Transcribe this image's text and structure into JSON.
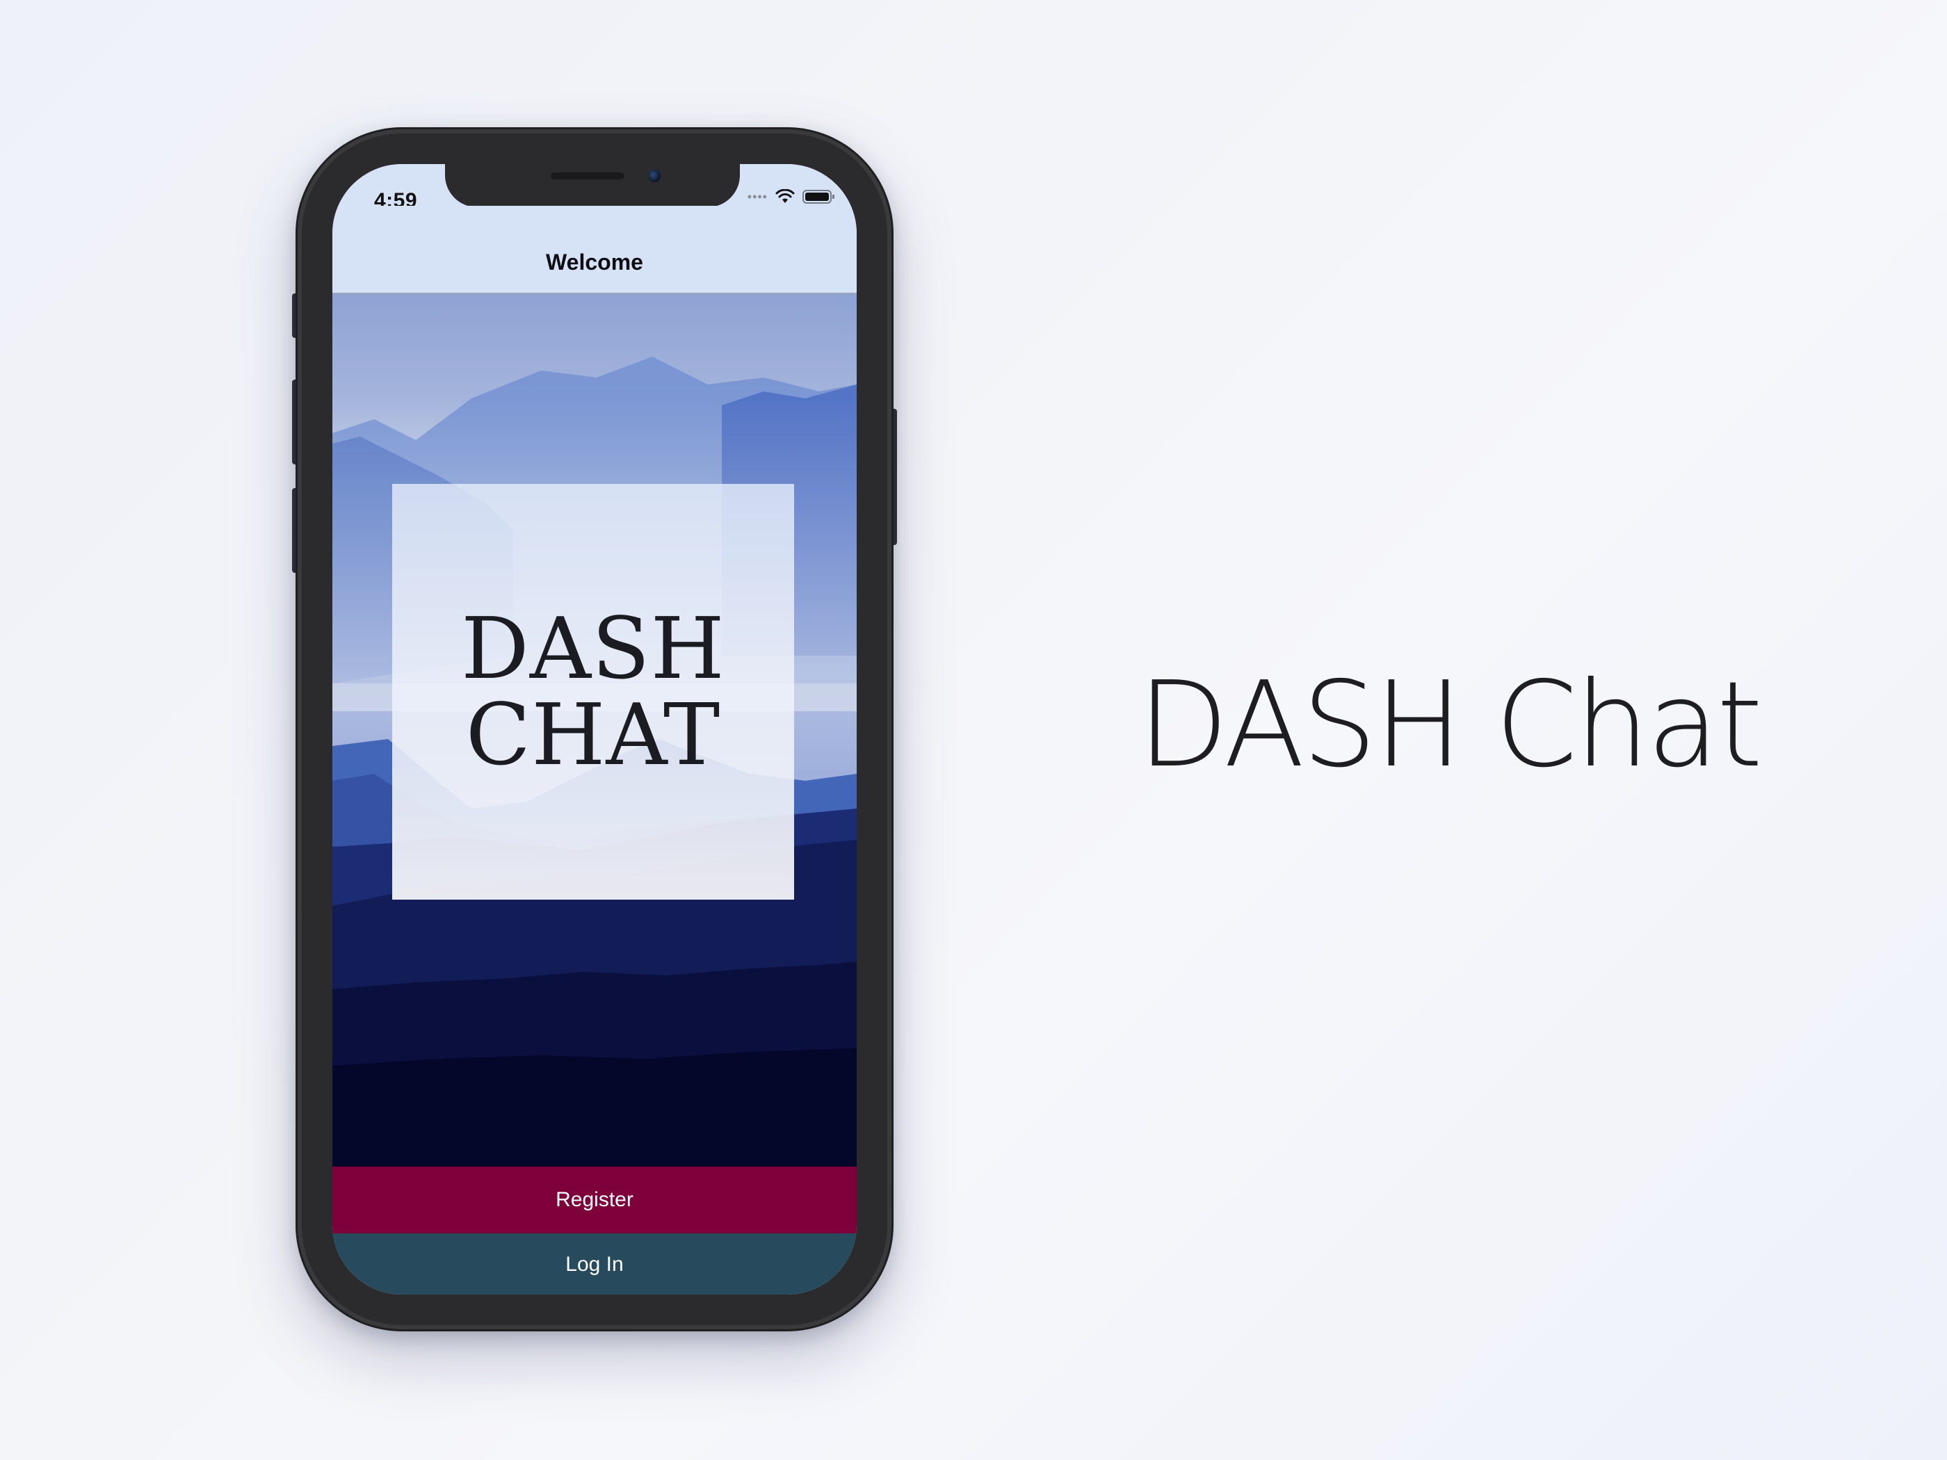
{
  "status_bar": {
    "time": "4:59",
    "signal_icon": "signal-dots-icon",
    "wifi_icon": "wifi-icon",
    "battery_icon": "battery-icon"
  },
  "nav": {
    "title": "Welcome"
  },
  "logo": {
    "line1": "DASH",
    "line2": "CHAT"
  },
  "buttons": {
    "register": "Register",
    "login": "Log In"
  },
  "showcase": {
    "app_name": "DASH Chat"
  },
  "colors": {
    "register_bg": "#7e003a",
    "login_bg": "#274b5d",
    "nav_bg": "#d6e2f6"
  }
}
